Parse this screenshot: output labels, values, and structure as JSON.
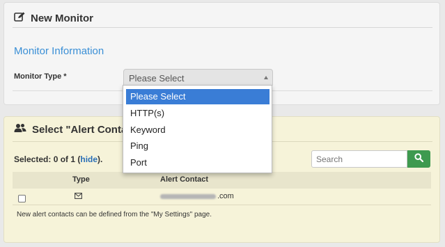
{
  "new_monitor": {
    "title": "New Monitor",
    "icon": "edit-icon",
    "section_title": "Monitor Information",
    "monitor_type_label": "Monitor Type *",
    "monitor_type_value": "Please Select"
  },
  "dropdown": {
    "options": [
      "Please Select",
      "HTTP(s)",
      "Keyword",
      "Ping",
      "Port"
    ],
    "highlighted_index": 0,
    "highlight_color": "#3a7dd6"
  },
  "alert_contacts": {
    "title": "Select \"Alert Conta",
    "icon": "users-icon",
    "selected_prefix": "Selected: 0 of 1 (",
    "hide_link": "hide",
    "selected_suffix": ").",
    "search_placeholder": "Search",
    "search_button_color": "#3e9a4f",
    "columns": [
      "Type",
      "Alert Contact"
    ],
    "rows": [
      {
        "type_icon": "email-icon",
        "contact_suffix": ".com",
        "checked": false
      }
    ],
    "note": "New alert contacts can be defined from the \"My Settings\" page."
  }
}
